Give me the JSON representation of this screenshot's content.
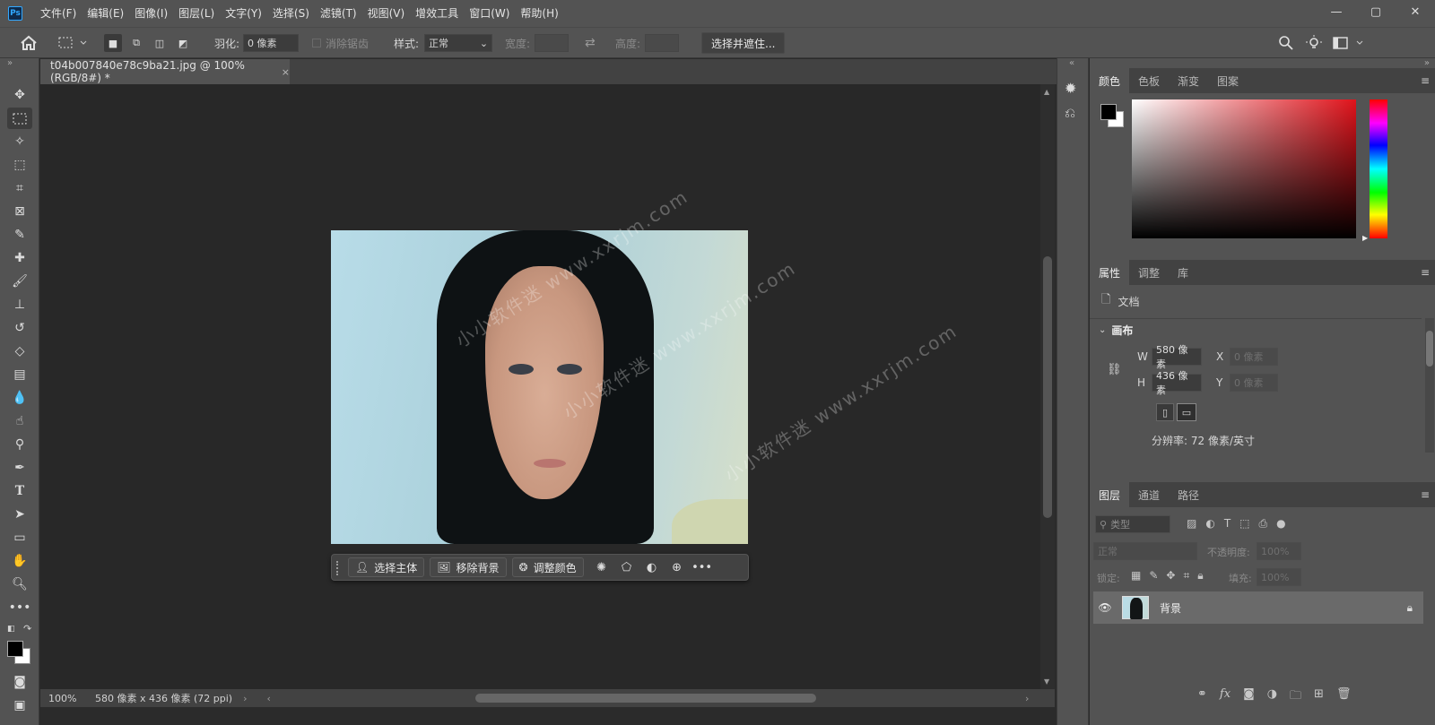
{
  "menubar": {
    "logo": "Ps",
    "items": [
      "文件(F)",
      "编辑(E)",
      "图像(I)",
      "图层(L)",
      "文字(Y)",
      "选择(S)",
      "滤镜(T)",
      "视图(V)",
      "增效工具",
      "窗口(W)",
      "帮助(H)"
    ],
    "window_controls": [
      "—",
      "▢",
      "✕"
    ]
  },
  "options": {
    "feather_label": "羽化:",
    "feather_value": "0 像素",
    "antialias_label": "消除锯齿",
    "style_label": "样式:",
    "style_value": "正常",
    "width_label": "宽度:",
    "height_label": "高度:",
    "select_mask_button": "选择并遮住..."
  },
  "doc": {
    "tab_title": "t04b007840e78c9ba21.jpg @ 100%(RGB/8#) *",
    "close": "×"
  },
  "context_bar": {
    "select_subject": "选择主体",
    "remove_bg": "移除背景",
    "adjust_color": "调整颜色"
  },
  "status": {
    "zoom": "100%",
    "dimensions": "580 像素 x 436 像素 (72 ppi)"
  },
  "watermarks": [
    "小小软件迷 www.xxrjm.com",
    "小小软件迷 www.xxrjm.com",
    "小小软件迷 www.xxrjm.com"
  ],
  "color_panel": {
    "tabs": [
      "颜色",
      "色板",
      "渐变",
      "图案"
    ]
  },
  "properties_panel": {
    "tabs": [
      "属性",
      "调整",
      "库"
    ],
    "doc_label": "文档",
    "section": "画布",
    "w_label": "W",
    "w_value": "580 像素",
    "h_label": "H",
    "h_value": "436 像素",
    "x_label": "X",
    "x_value": "0 像素",
    "y_label": "Y",
    "y_value": "0 像素",
    "resolution": "分辨率: 72 像素/英寸"
  },
  "layers_panel": {
    "tabs": [
      "图层",
      "通道",
      "路径"
    ],
    "kind_placeholder": "类型",
    "blend_mode": "正常",
    "opacity_label": "不透明度:",
    "opacity_value": "100%",
    "lock_label": "锁定:",
    "fill_label": "填充:",
    "fill_value": "100%",
    "layer_name": "背景"
  },
  "colors": {
    "accent": "#31a8ff",
    "panel_bg": "#535353",
    "canvas_bg": "#282828"
  }
}
